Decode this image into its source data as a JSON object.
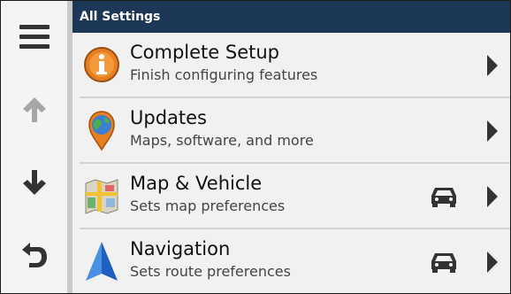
{
  "header": {
    "title": "All Settings"
  },
  "sidebar": {
    "buttons": [
      {
        "name": "menu-button",
        "icon": "hamburger-menu-icon",
        "enabled": true
      },
      {
        "name": "scroll-up-button",
        "icon": "arrow-up-icon",
        "enabled": false
      },
      {
        "name": "scroll-down-button",
        "icon": "arrow-down-icon",
        "enabled": true
      },
      {
        "name": "back-button",
        "icon": "back-arrow-icon",
        "enabled": true
      }
    ]
  },
  "items": [
    {
      "title": "Complete Setup",
      "subtitle": "Finish configuring features",
      "icon": "info-icon",
      "vehicle_icon": false
    },
    {
      "title": "Updates",
      "subtitle": "Maps, software, and more",
      "icon": "globe-pin-icon",
      "vehicle_icon": false
    },
    {
      "title": "Map & Vehicle",
      "subtitle": "Sets map preferences",
      "icon": "map-icon",
      "vehicle_icon": true
    },
    {
      "title": "Navigation",
      "subtitle": "Sets route preferences",
      "icon": "navigation-arrow-icon",
      "vehicle_icon": true
    }
  ],
  "colors": {
    "header_bg": "#1d3757",
    "active_icon": "#333333",
    "disabled_icon": "#a6a6a6",
    "info_orange": "#e67e22",
    "nav_blue": "#1f5fbf"
  }
}
